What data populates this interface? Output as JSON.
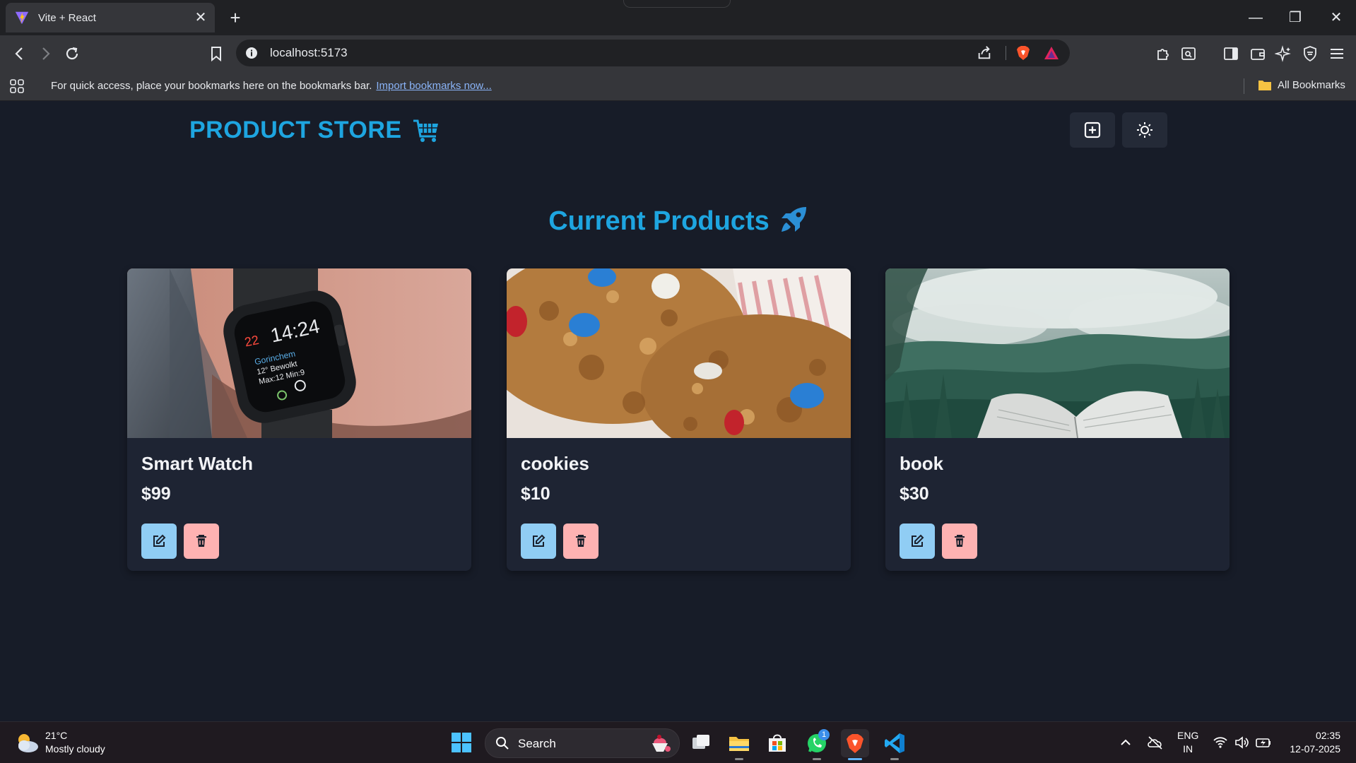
{
  "browser": {
    "tab_title": "Vite + React",
    "url": "localhost:5173",
    "bookmarks_message": "For quick access, place your bookmarks here on the bookmarks bar.",
    "bookmarks_link": "Import bookmarks now...",
    "all_bookmarks": "All Bookmarks"
  },
  "app": {
    "brand": "PRODUCT STORE",
    "heading": "Current Products",
    "accent_color": "#1ea5e0",
    "products": [
      {
        "name": "Smart Watch",
        "price": "$99",
        "image": "smartwatch-photo"
      },
      {
        "name": "cookies",
        "price": "$10",
        "image": "cookies-photo"
      },
      {
        "name": "book",
        "price": "$30",
        "image": "book-forest-photo"
      }
    ],
    "watch_face": {
      "date": "22",
      "time": "14:24",
      "line1": "Gorinchem",
      "line2": "12° Bewolkt",
      "line3": "Max:12 Min:9"
    }
  },
  "taskbar": {
    "temperature": "21°C",
    "weather": "Mostly cloudy",
    "search_label": "Search",
    "whatsapp_badge": "1",
    "lang_top": "ENG",
    "lang_bottom": "IN",
    "time": "02:35",
    "date": "12-07-2025"
  }
}
